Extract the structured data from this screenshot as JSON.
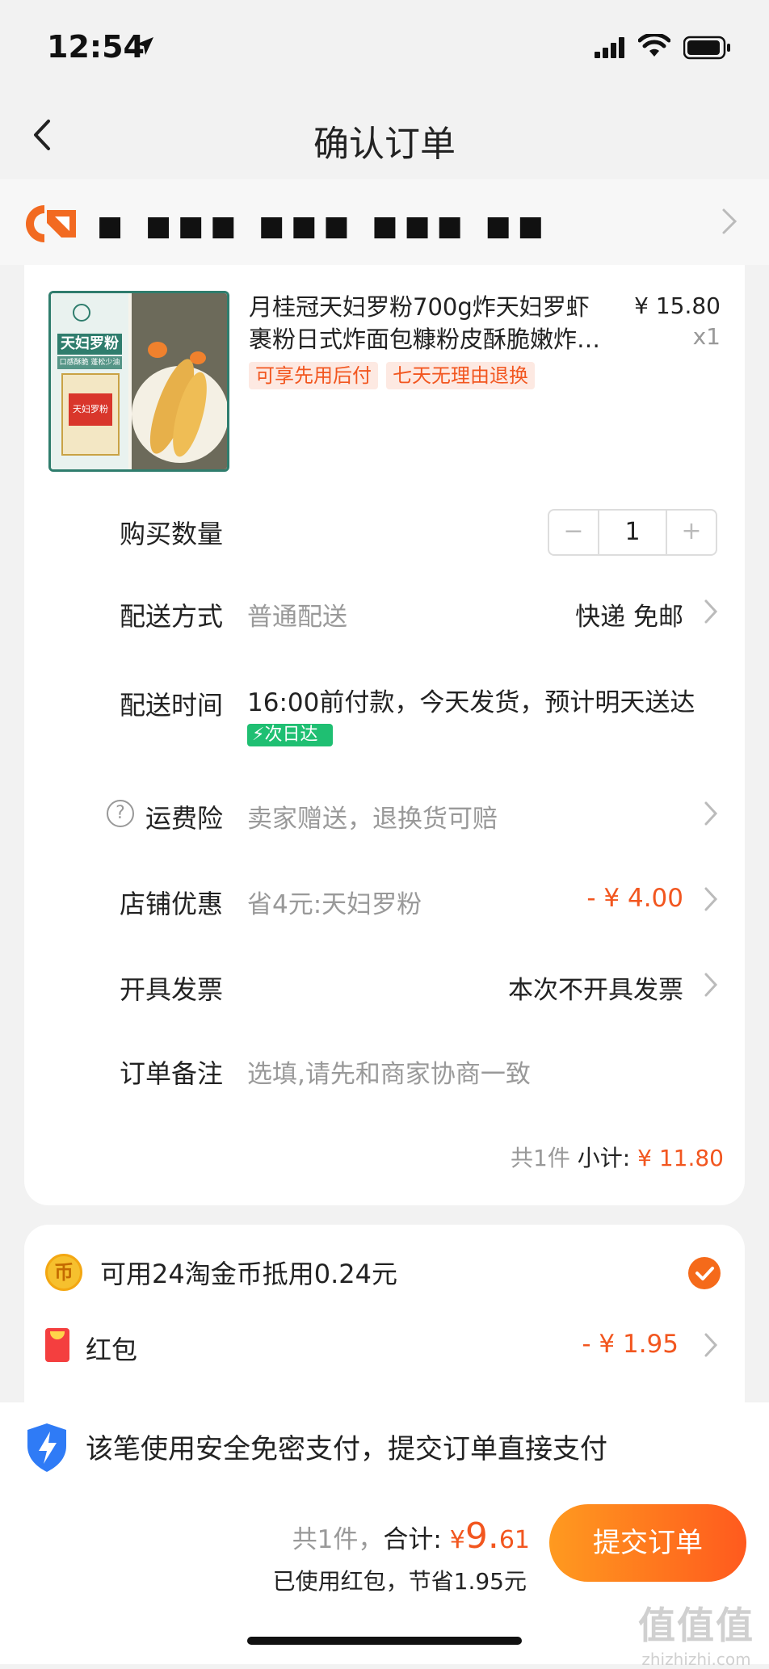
{
  "status_bar": {
    "time": "12:54"
  },
  "nav": {
    "title": "确认订单"
  },
  "shop": {
    "name": "■ ■■■ ■■■ ■■■ ■■"
  },
  "product": {
    "title": "月桂冠天妇罗粉700g炸天妇罗虾裹粉日式炸面包糠粉皮酥脆嫩炸…",
    "price": "¥ 15.80",
    "qty": "x1",
    "tags": [
      "可享先用后付",
      "七天无理由退换"
    ],
    "thumb_texts": {
      "brand": "天妇罗粉",
      "sub": "口感酥脆 蓬松少油",
      "box": "天妇罗粉"
    }
  },
  "rows": {
    "quantity": {
      "label": "购买数量",
      "value": "1",
      "minus": "−",
      "plus": "+"
    },
    "delivery_method": {
      "label": "配送方式",
      "sub": "普通配送",
      "right": "快递 免邮"
    },
    "delivery_time": {
      "label": "配送时间",
      "sub": "16:00前付款，今天发货，预计明天送达",
      "badge": "次日达"
    },
    "shipping_insurance": {
      "label": "运费险",
      "sub": "卖家赠送，退换货可赔",
      "icon": "?"
    },
    "shop_discount": {
      "label": "店铺优惠",
      "sub": "省4元:天妇罗粉",
      "right": "- ¥ 4.00"
    },
    "invoice": {
      "label": "开具发票",
      "right": "本次不开具发票"
    },
    "remark": {
      "label": "订单备注",
      "placeholder": "选填,请先和商家协商一致"
    }
  },
  "subtotal": {
    "count": "共1件",
    "label": "小计:",
    "amount": "¥ 11.80"
  },
  "payment": {
    "coin_text": "可用24淘金币抵用0.24元",
    "coin_icon_text": "币",
    "redpack_label": "红包",
    "redpack_amount": "- ¥ 1.95"
  },
  "bottom": {
    "secure_text": "该笔使用安全免密支付，提交订单直接支付",
    "count": "共1件，",
    "total_label": "合计:",
    "currency": "¥",
    "total_int": "9.",
    "total_dec": "61",
    "saved": "已使用红包，节省1.95元",
    "submit": "提交订单"
  },
  "watermark": {
    "big": "值值值",
    "small": "zhizhizhi.com"
  },
  "colors": {
    "accent": "#f2561f",
    "button_start": "#ff9a1f",
    "button_end": "#ff5a1e",
    "badge_green": "#1fbf72"
  }
}
